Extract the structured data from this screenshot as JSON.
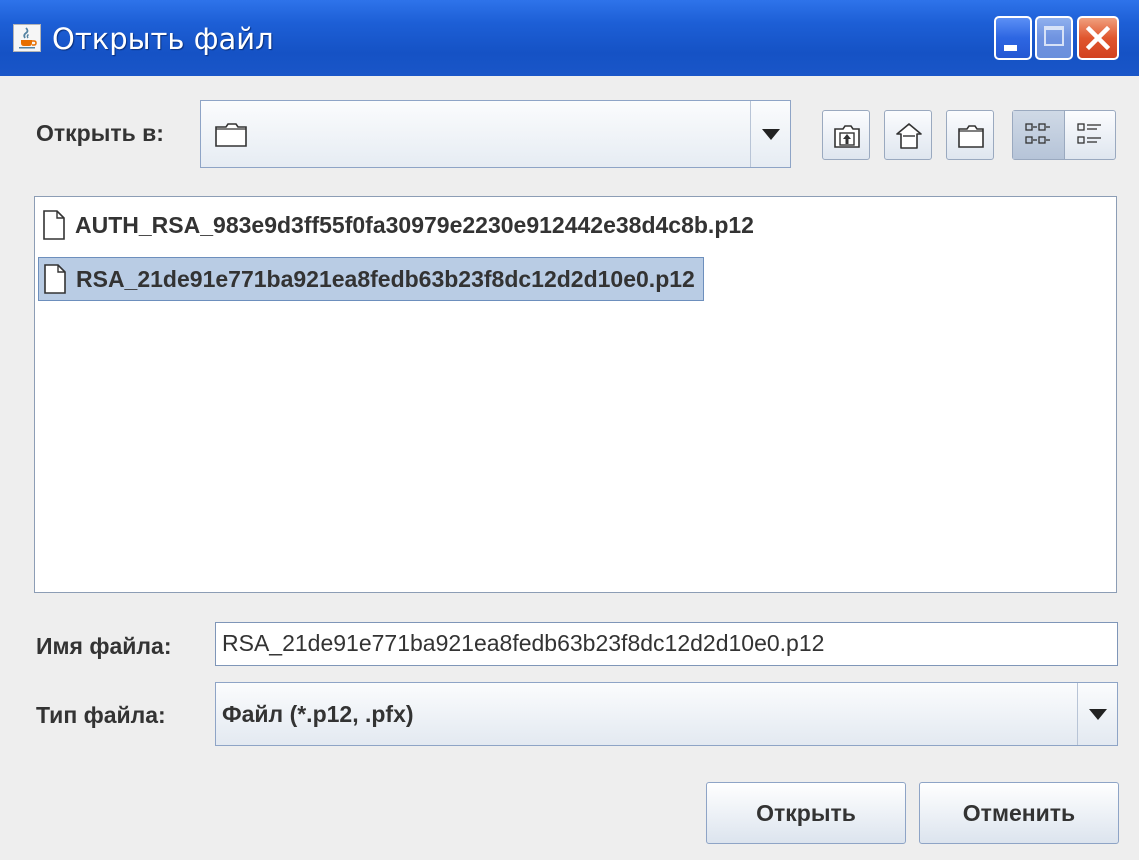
{
  "window": {
    "title": "Открыть файл",
    "title_icon": "java-cup-icon",
    "controls": [
      "minimize-icon",
      "maximize-icon",
      "close-icon"
    ]
  },
  "look_in": {
    "label": "Открыть в:",
    "value": "",
    "icon": "folder-icon"
  },
  "toolbar": {
    "buttons": [
      "up-folder-icon",
      "home-icon",
      "new-folder-icon",
      "list-view-icon",
      "details-view-icon"
    ],
    "selected_view": "list"
  },
  "files": {
    "items": [
      {
        "name": "AUTH_RSA_983e9d3ff55f0fa30979e2230e912442e38d4c8b.p12",
        "selected": false,
        "icon": "file-icon"
      },
      {
        "name": "RSA_21de91e771ba921ea8fedb63b23f8dc12d2d10e0.p12",
        "selected": true,
        "icon": "file-icon"
      }
    ]
  },
  "file_name": {
    "label": "Имя файла:",
    "value": "RSA_21de91e771ba921ea8fedb63b23f8dc12d2d10e0.p12"
  },
  "file_type": {
    "label": "Тип файла:",
    "value": "Файл (*.p12, .pfx)"
  },
  "actions": {
    "open_label": "Открыть",
    "cancel_label": "Отменить"
  },
  "colors": {
    "titlebar": "#1d5fd6",
    "selection": "#b9cce4",
    "close_button": "#e0562e"
  }
}
